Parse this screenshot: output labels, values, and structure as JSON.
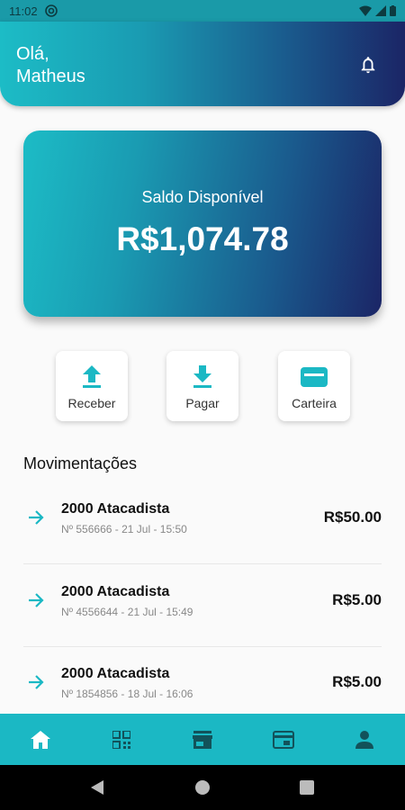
{
  "status_bar": {
    "time": "11:02"
  },
  "header": {
    "greeting_line1": "Olá,",
    "greeting_line2": "Matheus"
  },
  "balance": {
    "label": "Saldo Disponível",
    "value": "R$1,074.78"
  },
  "actions": [
    {
      "label": "Receber",
      "icon": "upload-icon"
    },
    {
      "label": "Pagar",
      "icon": "download-icon"
    },
    {
      "label": "Carteira",
      "icon": "wallet-card-icon"
    }
  ],
  "transactions_section": {
    "title": "Movimentações"
  },
  "transactions": [
    {
      "title": "2000 Atacadista",
      "subtitle": "Nº 556666 - 21 Jul - 15:50",
      "amount": "R$50.00"
    },
    {
      "title": "2000 Atacadista",
      "subtitle": "Nº 4556644 - 21 Jul - 15:49",
      "amount": "R$5.00"
    },
    {
      "title": "2000 Atacadista",
      "subtitle": "Nº 1854856 - 18 Jul - 16:06",
      "amount": "R$5.00"
    }
  ],
  "bottom_nav": [
    "home-icon",
    "qr-code-icon",
    "store-icon",
    "account-balance-icon",
    "person-icon"
  ],
  "colors": {
    "accent": "#1bb8c4",
    "gradient_start": "#1cbcc6",
    "gradient_end": "#1b2566"
  }
}
